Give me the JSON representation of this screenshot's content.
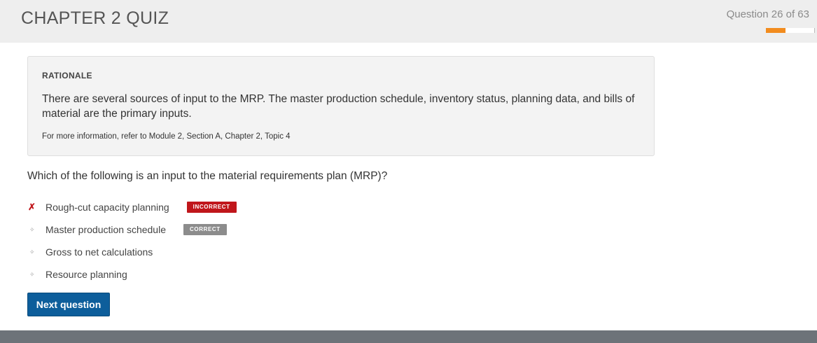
{
  "header": {
    "title": "CHAPTER 2 QUIZ",
    "counter": "Question 26 of 63",
    "progress": 0.413,
    "progress_color": "#f28c1e"
  },
  "rationale": {
    "heading": "RATIONALE",
    "text": "There are several sources of input to the MRP. The master production schedule, inventory status, planning data, and bills of material are the primary inputs.",
    "reference": "For more information, refer to Module 2, Section A, Chapter 2, Topic 4"
  },
  "question": {
    "text": "Which of the following is an input to the material requirements plan (MRP)?"
  },
  "answers": [
    {
      "marker": "✗",
      "label": "Rough-cut capacity planning",
      "badge": "INCORRECT"
    },
    {
      "marker": "✧",
      "label": "Master production schedule",
      "badge": "CORRECT"
    },
    {
      "marker": "✧",
      "label": "Gross to net calculations"
    },
    {
      "marker": "✧",
      "label": "Resource planning"
    }
  ],
  "next_button": {
    "label": "Next question"
  }
}
